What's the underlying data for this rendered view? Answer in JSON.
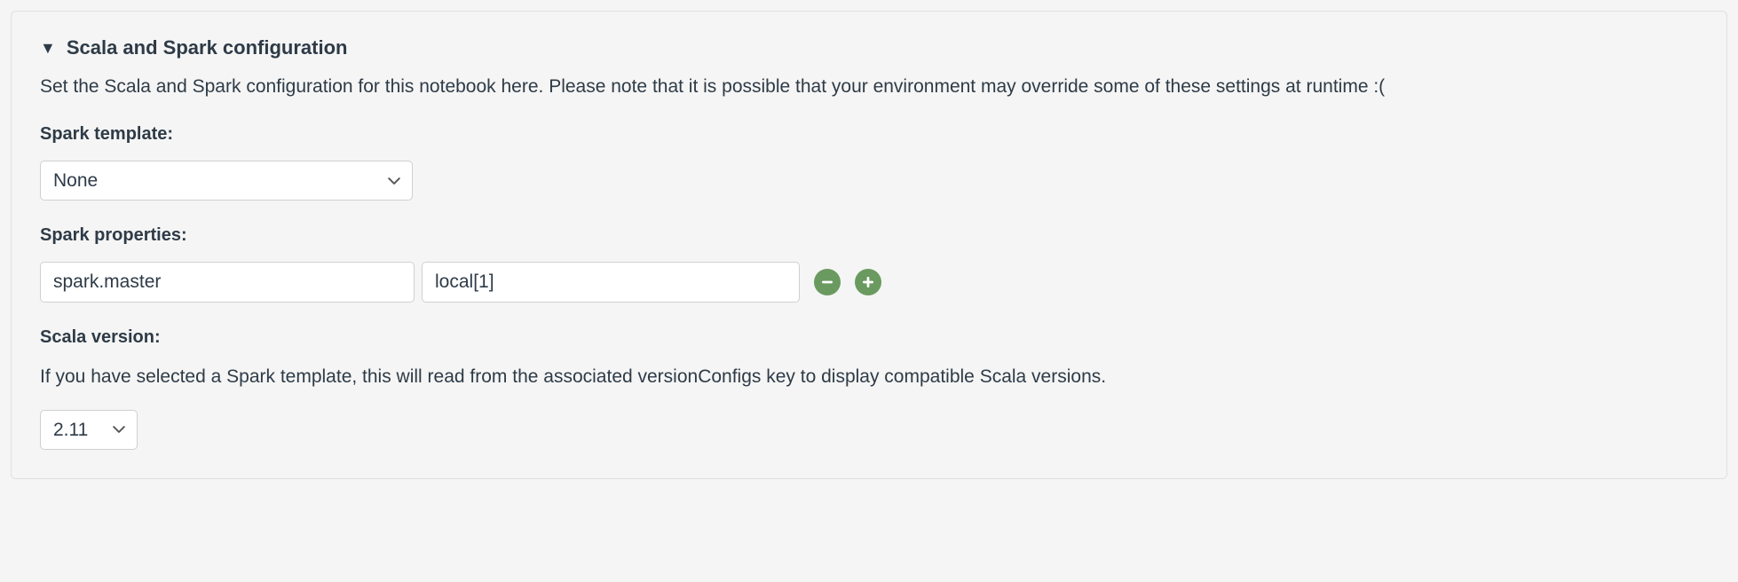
{
  "section": {
    "title": "Scala and Spark configuration",
    "description": "Set the Scala and Spark configuration for this notebook here. Please note that it is possible that your environment may override some of these settings at runtime :("
  },
  "spark_template": {
    "label": "Spark template:",
    "selected": "None"
  },
  "spark_properties": {
    "label": "Spark properties:",
    "rows": [
      {
        "key": "spark.master",
        "value": "local[1]"
      }
    ]
  },
  "scala_version": {
    "label": "Scala version:",
    "helper": "If you have selected a Spark template, this will read from the associated versionConfigs key to display compatible Scala versions.",
    "selected": "2.11"
  },
  "colors": {
    "icon_green": "#6a9a5f",
    "text_dark": "#2e3b47"
  }
}
